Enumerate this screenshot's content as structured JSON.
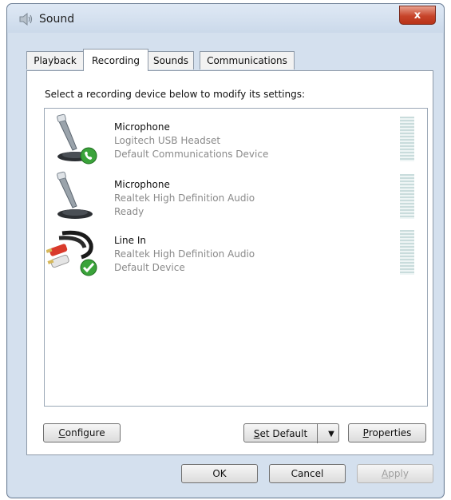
{
  "window": {
    "title": "Sound",
    "close_label": "x"
  },
  "tabs": [
    {
      "label": "Playback"
    },
    {
      "label": "Recording",
      "active": true
    },
    {
      "label": "Sounds"
    },
    {
      "label": "Communications"
    }
  ],
  "panel": {
    "instruction": "Select a recording device below to modify its settings:"
  },
  "devices": [
    {
      "name": "Microphone",
      "driver": "Logitech USB Headset",
      "status": "Default Communications Device",
      "icon": "microphone-icon",
      "badge": "phone-badge-icon"
    },
    {
      "name": "Microphone",
      "driver": "Realtek High Definition Audio",
      "status": "Ready",
      "icon": "microphone-icon"
    },
    {
      "name": "Line In",
      "driver": "Realtek High Definition Audio",
      "status": "Default Device",
      "icon": "rca-cable-icon",
      "badge": "checkmark-badge-icon"
    }
  ],
  "buttons": {
    "configure": {
      "hotkey": "C",
      "rest": "onfigure"
    },
    "set_default": {
      "hotkey": "S",
      "rest": "et Default"
    },
    "set_default_arrow": "▼",
    "properties": {
      "hotkey": "P",
      "rest": "roperties"
    },
    "ok": "OK",
    "cancel": "Cancel",
    "apply": {
      "hotkey": "A",
      "rest": "pply"
    }
  },
  "colors": {
    "badge_green": "#3aa33a",
    "close_red": "#c7442a"
  }
}
